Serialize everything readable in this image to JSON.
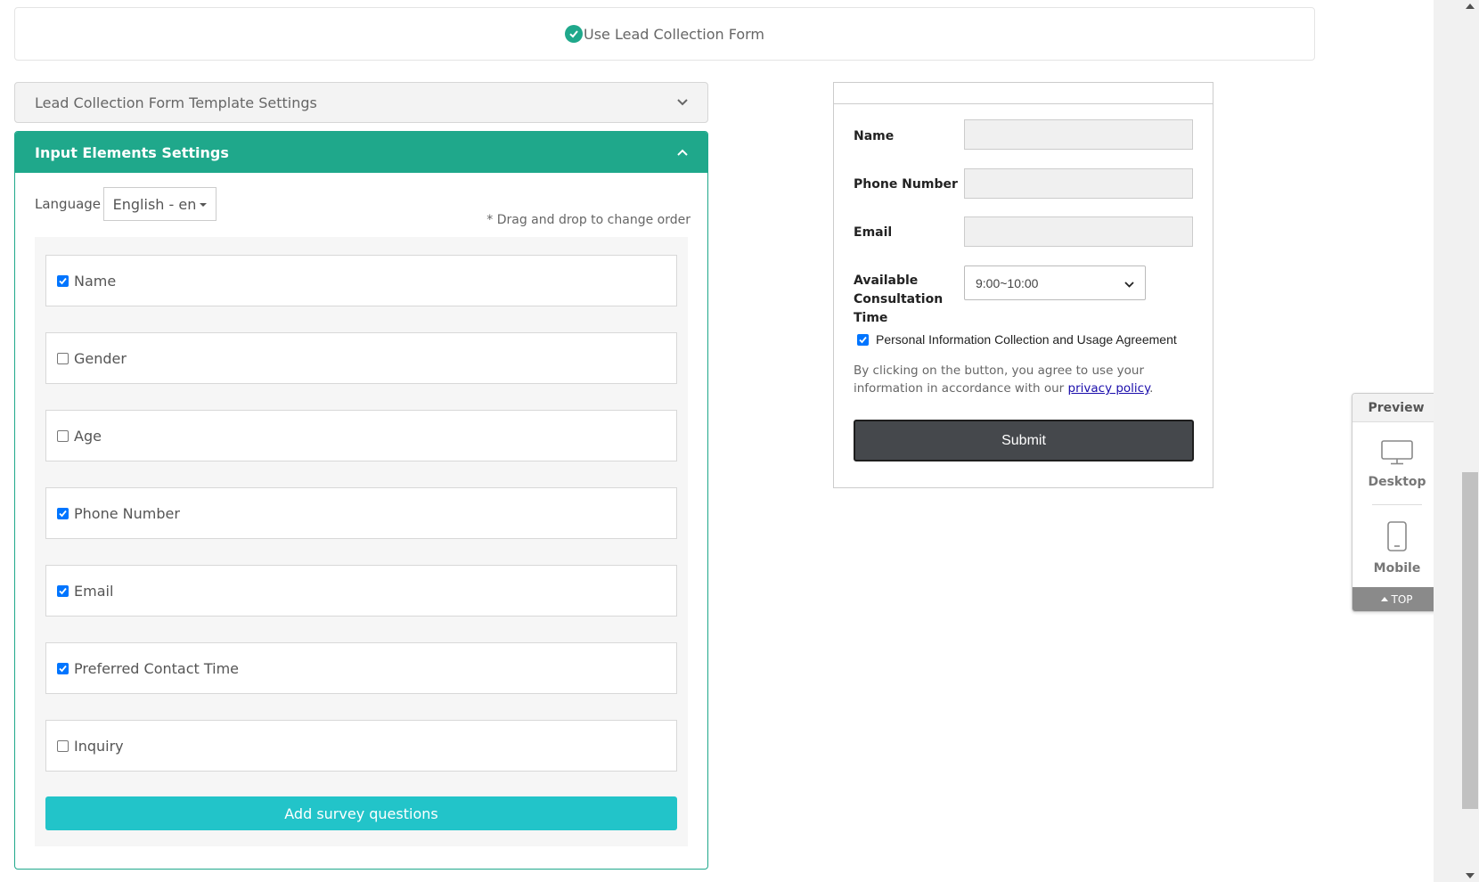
{
  "banner": {
    "label": "Use Lead Collection Form"
  },
  "template_settings": {
    "title": "Lead Collection Form Template Settings"
  },
  "input_settings": {
    "title": "Input Elements Settings",
    "language_label": "Language",
    "language_value": "English - en",
    "drag_hint": "* Drag and drop to change order",
    "elements": [
      {
        "label": "Name",
        "checked": true
      },
      {
        "label": "Gender",
        "checked": false
      },
      {
        "label": "Age",
        "checked": false
      },
      {
        "label": "Phone Number",
        "checked": true
      },
      {
        "label": "Email",
        "checked": true
      },
      {
        "label": "Preferred Contact Time",
        "checked": true
      },
      {
        "label": "Inquiry",
        "checked": false
      }
    ],
    "add_survey_label": "Add survey questions"
  },
  "preview_form": {
    "name_label": "Name",
    "phone_label": "Phone Number",
    "email_label": "Email",
    "time_label_1": "Available",
    "time_label_2": "Consultation",
    "time_label_3": "Time",
    "time_value": "9:00~10:00",
    "agreement": "Personal Information Collection and Usage Agreement",
    "note_before": "By clicking on the button, you agree to use your information in accordance with our ",
    "note_link": "privacy policy",
    "note_after": ".",
    "submit_label": "Submit"
  },
  "preview_widget": {
    "title": "Preview",
    "desktop_label": "Desktop",
    "mobile_label": "Mobile",
    "top_label": "TOP"
  },
  "colors": {
    "accent": "#1fa88b",
    "survey_button": "#22c4c9",
    "submit_button": "#45484c",
    "checkbox": "#0075ff"
  },
  "icons": [
    "check-circle-icon",
    "chevron-down-icon",
    "chevron-up-icon",
    "caret-down-icon",
    "desktop-icon",
    "mobile-icon",
    "arrow-up-icon"
  ]
}
